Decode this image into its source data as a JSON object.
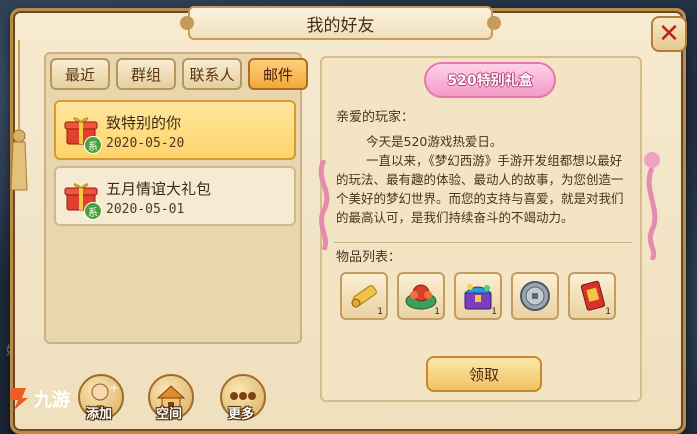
{
  "window": {
    "title": "我的好友"
  },
  "tabs": [
    {
      "label": "最近"
    },
    {
      "label": "群组"
    },
    {
      "label": "联系人"
    },
    {
      "label": "邮件"
    }
  ],
  "mails": [
    {
      "title": "致特别的你",
      "date": "2020-05-20",
      "badge": "系"
    },
    {
      "title": "五月情谊大礼包",
      "date": "2020-05-01",
      "badge": "系"
    }
  ],
  "letter": {
    "banner": "520特别礼盒",
    "greeting": "亲爱的玩家：",
    "para1": "今天是520游戏热爱日。",
    "para2": "一直以来，《梦幻西游》手游开发组都想以最好的玩法、最有趣的体验、最动人的故事，为您创造一个美好的梦幻世界。而您的支持与喜爱，就是对我们的最高认可，是我们持续奋斗的不竭动力。"
  },
  "items": {
    "label": "物品列表：",
    "slots": [
      {
        "icon": "golden-scroll-icon",
        "qty": "1"
      },
      {
        "icon": "flower-bowl-icon",
        "qty": "1"
      },
      {
        "icon": "treasure-chest-icon",
        "qty": "1"
      },
      {
        "icon": "silver-coin-icon",
        "qty": ""
      },
      {
        "icon": "red-charm-icon",
        "qty": "1"
      }
    ]
  },
  "claim": {
    "label": "领取"
  },
  "bottom": {
    "add_label": "添加",
    "space_label": "空间",
    "more_label": "更多",
    "side_text": "好友"
  },
  "watermark": {
    "text": "九游"
  },
  "colors": {
    "accent": "#f3a83d",
    "parchment": "#f3e4c4",
    "close": "#c0241c"
  }
}
